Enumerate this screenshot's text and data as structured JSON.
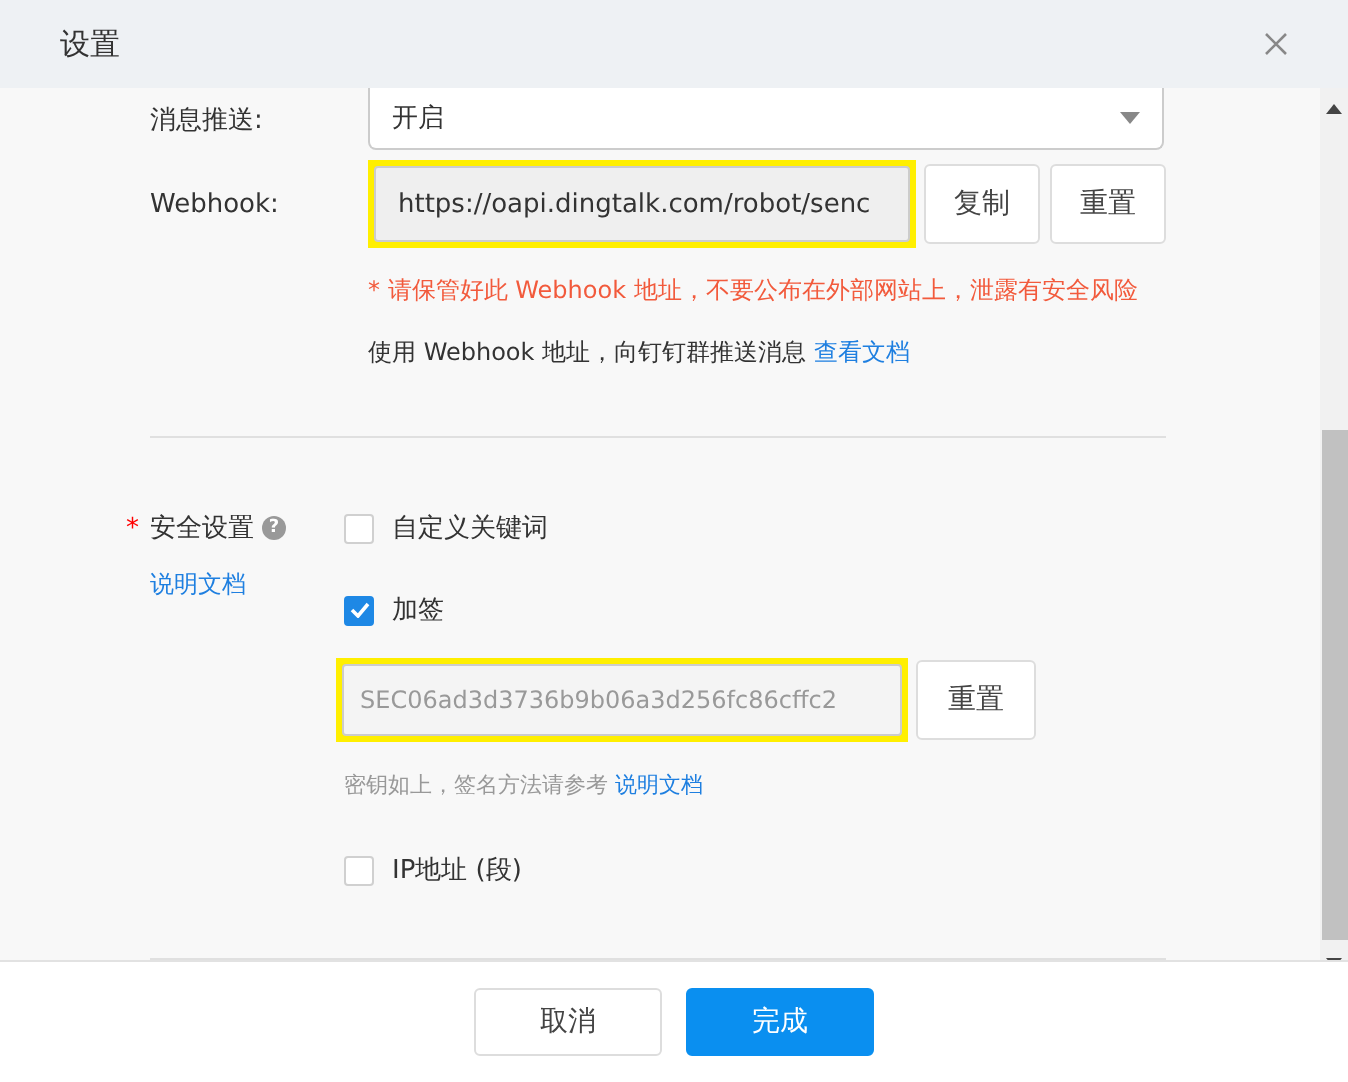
{
  "dialog": {
    "title": "设置"
  },
  "push": {
    "label": "消息推送:",
    "value": "开启"
  },
  "webhook": {
    "label": "Webhook:",
    "value": "https://oapi.dingtalk.com/robot/senc",
    "highlighted": true,
    "buttons": [
      "复制",
      "重置"
    ],
    "warning": "* 请保管好此 Webhook 地址，不要公布在外部网站上，泄露有安全风险",
    "info": "使用 Webhook 地址，向钉钉群推送消息",
    "info_link": "查看文档"
  },
  "security": {
    "required_mark": "*",
    "label": "安全设置",
    "help": "?",
    "doc_link": "说明文档",
    "options": [
      {
        "label": "自定义关键词",
        "checked": false
      },
      {
        "label": "加签",
        "checked": true,
        "secret": {
          "value": "SEC06ad3d3736b9b06a3d256fc86cffc2",
          "highlighted": true,
          "button": "重置",
          "hint": "密钥如上，签名方法请参考",
          "hint_link": "说明文档"
        }
      },
      {
        "label": "IP地址 (段)",
        "checked": false
      }
    ]
  },
  "footer": {
    "buttons": [
      {
        "label": "取消",
        "primary": false
      },
      {
        "label": "完成",
        "primary": true
      }
    ]
  }
}
